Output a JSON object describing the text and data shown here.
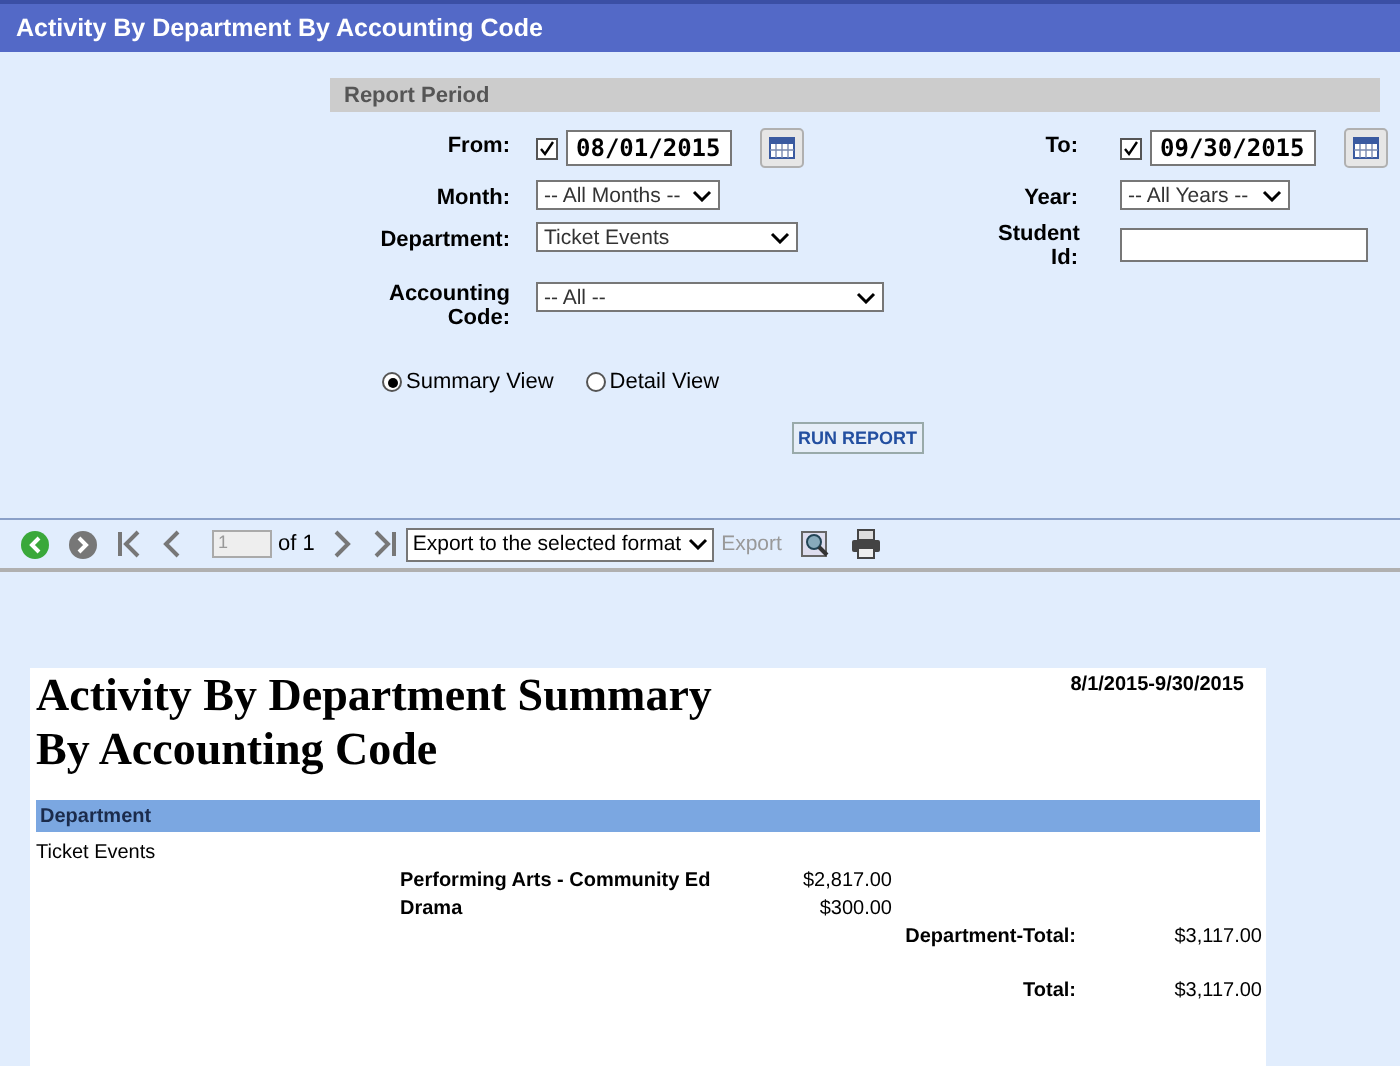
{
  "title": "Activity By Department By Accounting Code",
  "report_period": {
    "heading": "Report Period",
    "from": {
      "label": "From:",
      "checked": true,
      "value": "08/01/2015"
    },
    "to": {
      "label": "To:",
      "checked": true,
      "value": "09/30/2015"
    },
    "month": {
      "label": "Month:",
      "value": "-- All Months --"
    },
    "year": {
      "label": "Year:",
      "value": "-- All Years --"
    },
    "department": {
      "label": "Department:",
      "value": "Ticket Events"
    },
    "student_id": {
      "label": "Student Id:"
    },
    "accounting_code": {
      "label": "Accounting Code:",
      "value": "-- All --"
    },
    "views": [
      {
        "label": "Summary View",
        "selected": true
      },
      {
        "label": "Detail View",
        "selected": false
      }
    ],
    "run_button": "RUN REPORT"
  },
  "toolbar": {
    "page": "1",
    "of": "of 1",
    "export_format": "Export to the selected format",
    "export_button": "Export"
  },
  "report": {
    "title_lines": [
      "Activity By Department Summary",
      "By Accounting Code"
    ],
    "date_range": "8/1/2015-9/30/2015",
    "band": "Department",
    "department": "Ticket Events",
    "rows": [
      {
        "name": "Performing Arts - Community Ed",
        "amount": "$2,817.00"
      },
      {
        "name": "Drama",
        "amount": "$300.00"
      }
    ],
    "department_total": {
      "label": "Department-Total:",
      "value": "$3,117.00"
    },
    "total": {
      "label": "Total:",
      "value": "$3,117.00"
    }
  }
}
